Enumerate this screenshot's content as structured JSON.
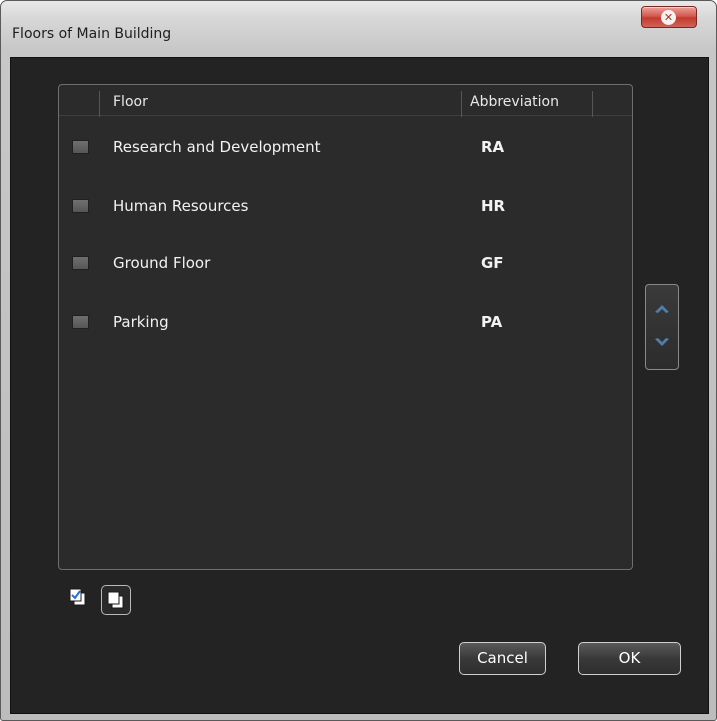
{
  "window": {
    "title": "Floors of Main Building"
  },
  "grid": {
    "columns": [
      "Floor",
      "Abbreviation"
    ],
    "rows": [
      {
        "floor": "Research and Development",
        "abbreviation": "RA"
      },
      {
        "floor": "Human Resources",
        "abbreviation": "HR"
      },
      {
        "floor": "Ground Floor",
        "abbreviation": "GF"
      },
      {
        "floor": "Parking",
        "abbreviation": "PA"
      }
    ]
  },
  "icons": {
    "close": "close-icon",
    "move_up": "chevron-up-icon",
    "move_down": "chevron-down-icon",
    "select_all": "select-all-icon",
    "select_none": "select-none-icon"
  },
  "buttons": {
    "cancel": "Cancel",
    "ok": "OK"
  }
}
